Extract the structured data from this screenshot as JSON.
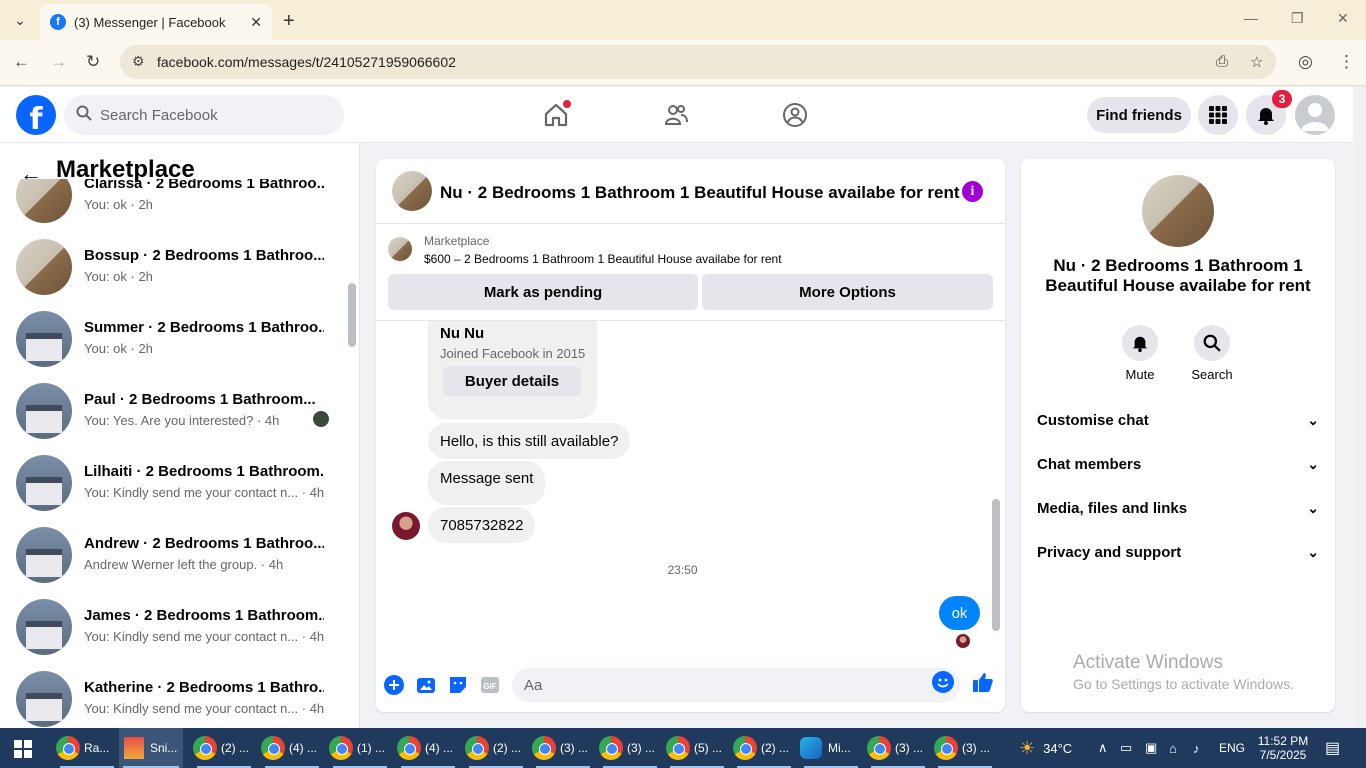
{
  "browser": {
    "tab_title": "(3) Messenger | Facebook",
    "url": "facebook.com/messages/t/24105271959066602"
  },
  "fb": {
    "search_placeholder": "Search Facebook",
    "find_friends": "Find friends",
    "notif_count": "3"
  },
  "sidebar": {
    "title": "Marketplace",
    "conversations": [
      {
        "name": "Clarissa · 2 Bedrooms 1 Bathroo...",
        "sub": "You: ok · 2h",
        "avatar": "room"
      },
      {
        "name": "Bossup · 2 Bedrooms 1 Bathroo...",
        "sub": "You: ok · 2h",
        "avatar": "room"
      },
      {
        "name": "Summer · 2 Bedrooms 1 Bathroo...",
        "sub": "You: ok · 2h",
        "avatar": "house"
      },
      {
        "name": "Paul · 2 Bedrooms 1 Bathroom...",
        "sub": "You: Yes. Are you interested? · 4h",
        "avatar": "house"
      },
      {
        "name": "Lilhaiti · 2 Bedrooms 1 Bathroom...",
        "sub": "You: Kindly send me your contact n... · 4h",
        "avatar": "house"
      },
      {
        "name": "Andrew · 2 Bedrooms 1 Bathroo...",
        "sub": "Andrew Werner left the group. · 4h",
        "avatar": "house"
      },
      {
        "name": "James · 2 Bedrooms 1 Bathroom...",
        "sub": "You: Kindly send me your contact n... · 4h",
        "avatar": "house"
      },
      {
        "name": "Katherine · 2 Bedrooms 1 Bathro...",
        "sub": "You: Kindly send me your contact n... · 4h",
        "avatar": "house"
      }
    ]
  },
  "chat": {
    "title": "Nu · 2 Bedrooms 1 Bathroom 1 Beautiful House availabe for rent",
    "marketplace_label": "Marketplace",
    "listing": "$600 – 2 Bedrooms 1 Bathroom 1 Beautiful House availabe for rent",
    "mark_pending": "Mark as pending",
    "more_options": "More Options",
    "buyer_name": "Nu Nu",
    "buyer_joined": "Joined Facebook in 2015",
    "buyer_details": "Buyer details",
    "messages": {
      "m1": "Hello, is this still available?",
      "m2": "Message sent",
      "m3": "7085732822",
      "timestamp": "23:50",
      "out": "ok"
    },
    "input_placeholder": "Aa"
  },
  "details": {
    "title": "Nu · 2 Bedrooms 1 Bathroom 1 Beautiful House availabe for rent",
    "mute": "Mute",
    "search": "Search",
    "sections": [
      "Customise chat",
      "Chat members",
      "Media, files and links",
      "Privacy and support"
    ]
  },
  "watermark": {
    "line1": "Activate Windows",
    "line2": "Go to Settings to activate Windows."
  },
  "taskbar": {
    "items": [
      "Ra...",
      "Sni...",
      "(2) ...",
      "(4) ...",
      "(1) ...",
      "(4) ...",
      "(2) ...",
      "(3) ...",
      "(3) ...",
      "(5) ...",
      "(2) ...",
      "Mi...",
      "(3) ...",
      "(3) ..."
    ],
    "temperature": "34°C",
    "lang": "ENG",
    "time": "11:52 PM",
    "date": "7/5/2025"
  },
  "colors": {
    "fb_blue": "#0866ff",
    "messenger_blue": "#0084ff",
    "badge_red": "#e41e3f"
  }
}
